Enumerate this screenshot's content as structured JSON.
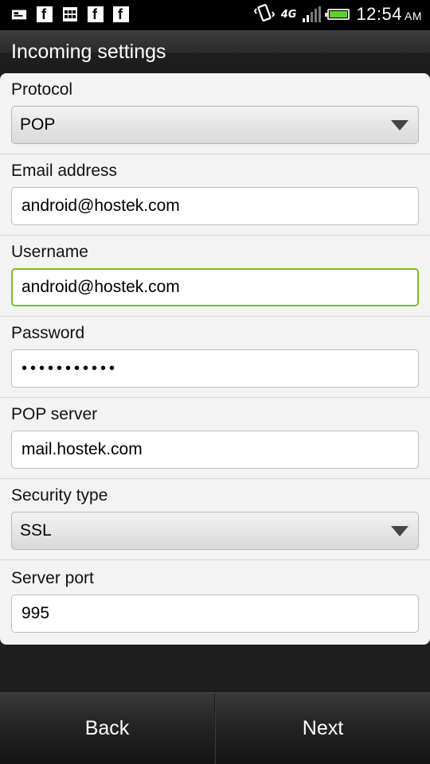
{
  "status_bar": {
    "time": "12:54",
    "ampm": "AM",
    "network": "4G",
    "icons": [
      "message-icon",
      "facebook-icon",
      "calendar-icon",
      "facebook-icon",
      "facebook-icon",
      "vibrate-icon",
      "signal-icon",
      "battery-icon"
    ],
    "fb_glyph": "f",
    "accent_color": "#5cd12a"
  },
  "header": {
    "title": "Incoming settings"
  },
  "form": {
    "protocol": {
      "label": "Protocol",
      "value": "POP"
    },
    "email": {
      "label": "Email address",
      "value": "android@hostek.com"
    },
    "username": {
      "label": "Username",
      "value": "android@hostek.com"
    },
    "password": {
      "label": "Password",
      "value": "•••••••••••"
    },
    "server": {
      "label": "POP server",
      "value": "mail.hostek.com"
    },
    "security": {
      "label": "Security type",
      "value": "SSL"
    },
    "port": {
      "label": "Server port",
      "value": "995"
    }
  },
  "buttons": {
    "back": "Back",
    "next": "Next"
  },
  "colors": {
    "focus_border": "#7bbf1e",
    "background": "#1e1e1e",
    "card": "#f3f3f3"
  }
}
